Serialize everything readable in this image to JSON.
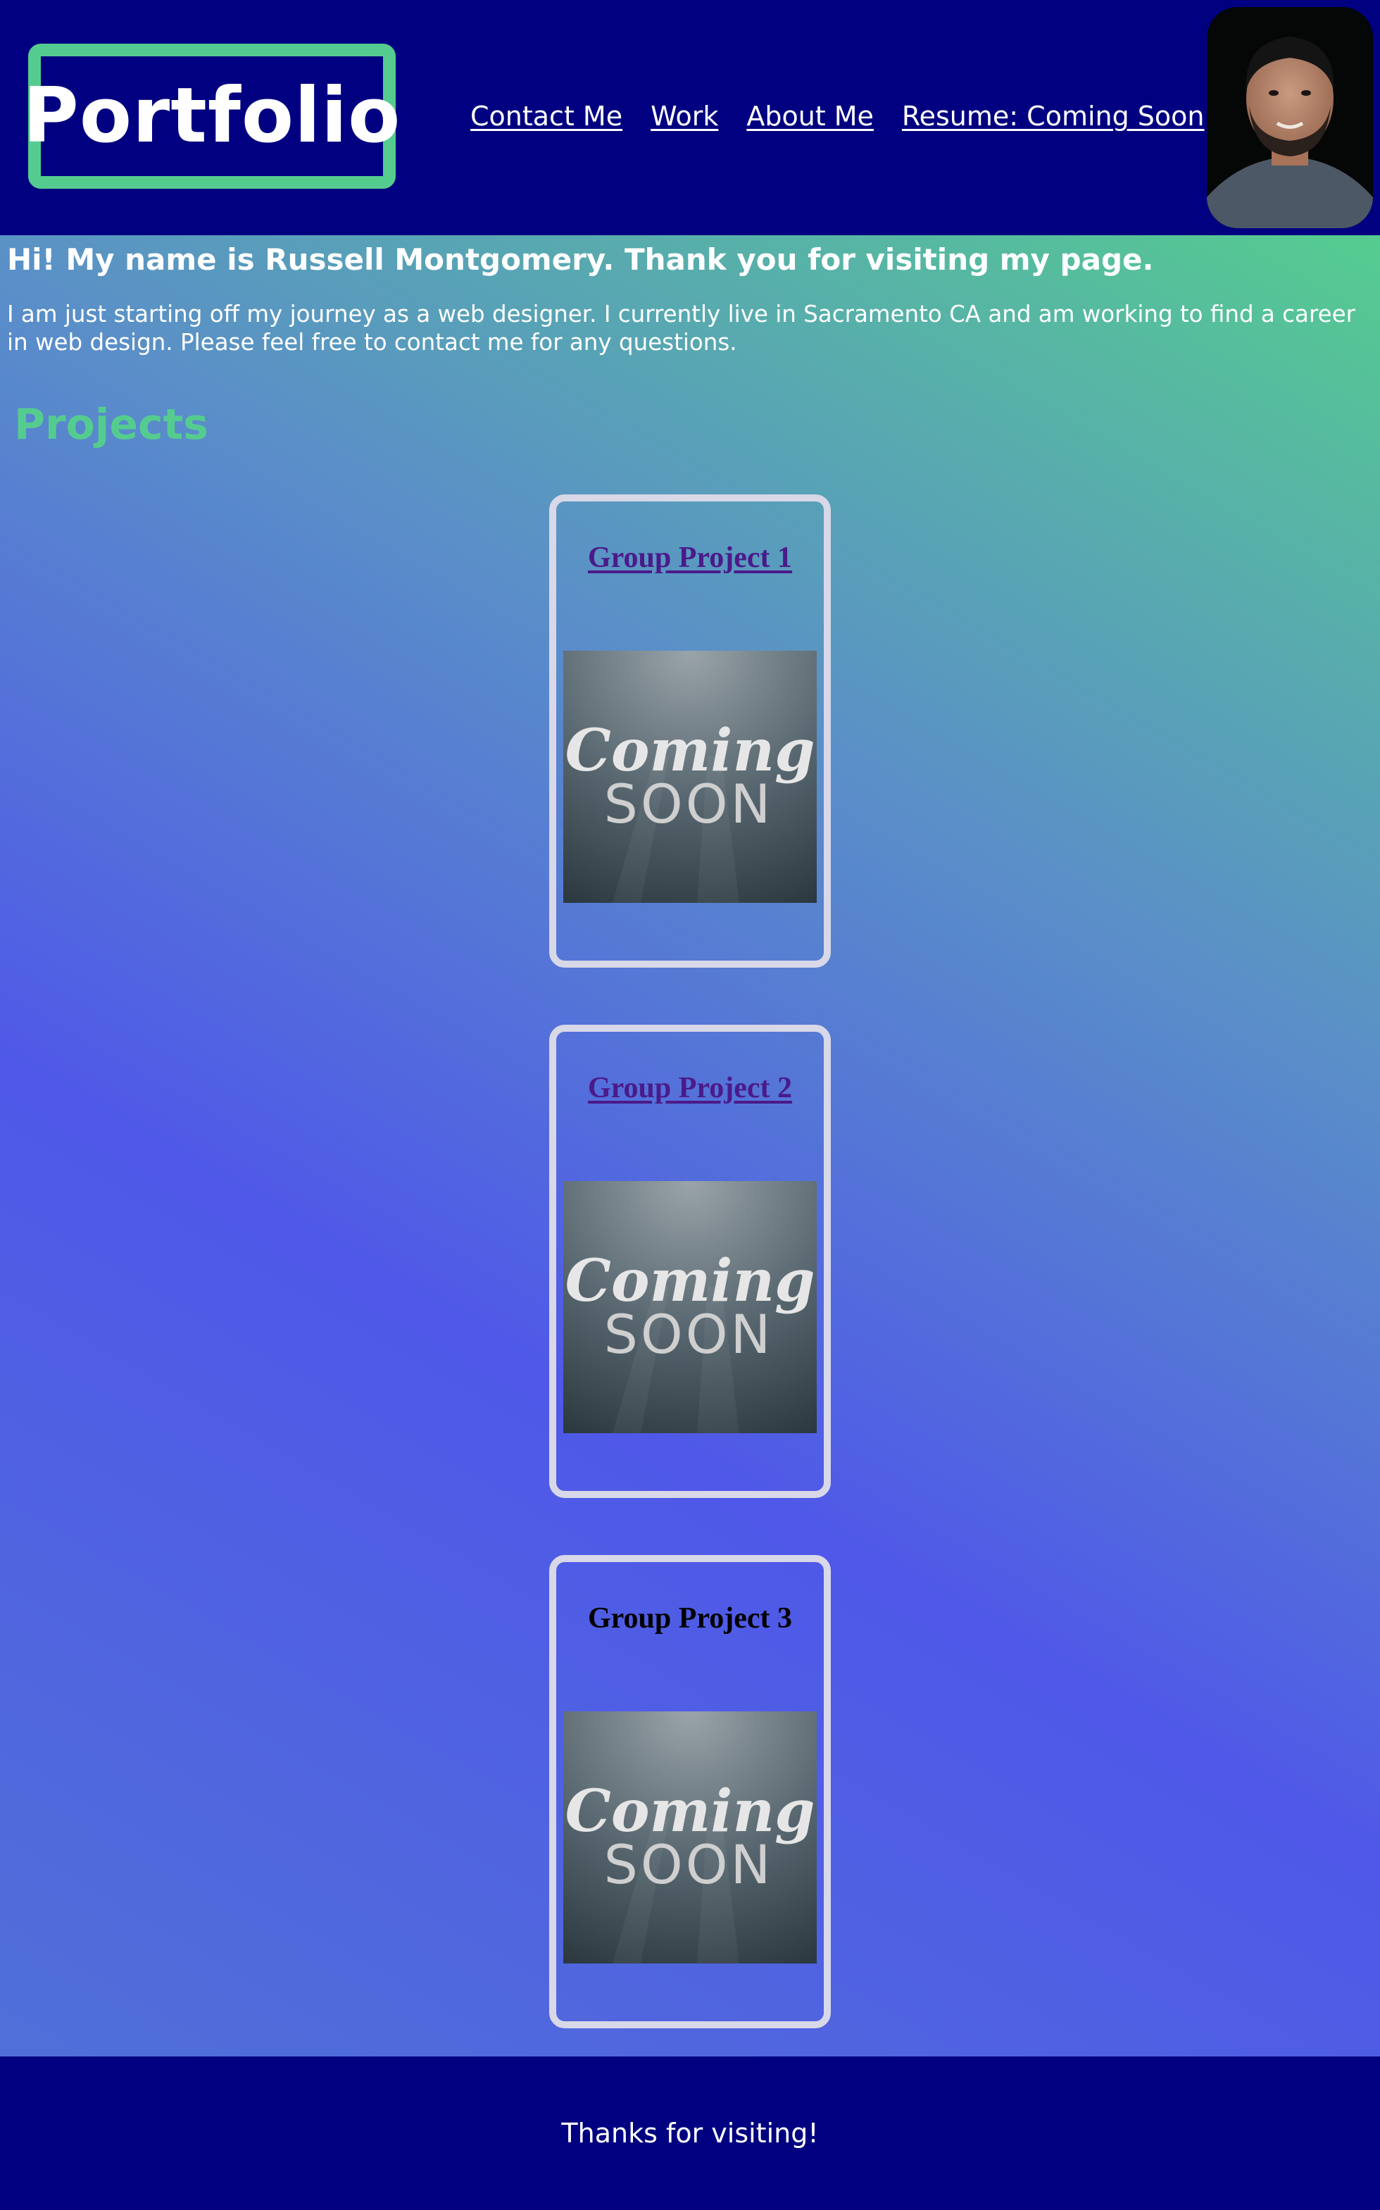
{
  "header": {
    "logo_text": "Portfolio",
    "nav": [
      {
        "label": "Contact Me"
      },
      {
        "label": "Work"
      },
      {
        "label": "About Me"
      },
      {
        "label": "Resume: Coming Soon"
      }
    ],
    "avatar_icon": "profile-photo"
  },
  "main": {
    "greeting": "Hi! My name is Russell Montgomery. Thank you for visiting my page.",
    "intro": "I am just starting off my journey as a web designer. I currently live in Sacramento CA and am working to find a career in web design. Please feel free to contact me for any questions.",
    "projects_heading": "Projects",
    "projects": [
      {
        "title": "Group Project 1",
        "image_text_1": "Coming",
        "image_text_2": "SOON"
      },
      {
        "title": "Group Project 2",
        "image_text_1": "Coming",
        "image_text_2": "SOON"
      },
      {
        "title": "Group Project 3",
        "image_text_1": "Coming",
        "image_text_2": "SOON"
      }
    ]
  },
  "footer": {
    "text": "Thanks for visiting!"
  },
  "colors": {
    "header_bg": "#000080",
    "accent_green": "#55cc8f",
    "gradient_blue": "#4f58e8",
    "link_purple": "#4a1a8a",
    "card_border": "#d8d8e8"
  }
}
